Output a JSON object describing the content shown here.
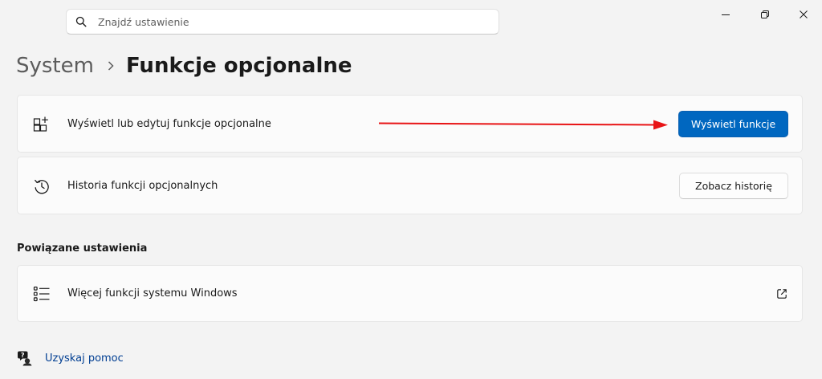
{
  "search": {
    "placeholder": "Znajdź ustawienie",
    "icon": "search-icon"
  },
  "window_controls": {
    "minimize_icon": "minimize-icon",
    "restore_icon": "restore-icon",
    "close_icon": "close-icon"
  },
  "breadcrumb": {
    "parent": "System",
    "current": "Funkcje opcjonalne"
  },
  "cards": [
    {
      "icon": "add-feature-icon",
      "label": "Wyświetl lub edytuj funkcje opcjonalne",
      "button": "Wyświetl funkcje"
    },
    {
      "icon": "history-icon",
      "label": "Historia funkcji opcjonalnych",
      "button": "Zobacz historię"
    }
  ],
  "related": {
    "title": "Powiązane ustawienia",
    "items": [
      {
        "icon": "list-icon",
        "label": "Więcej funkcji systemu Windows",
        "trailing_icon": "external-link-icon"
      }
    ]
  },
  "help": {
    "icon": "help-icon",
    "label": "Uzyskaj pomoc"
  },
  "colors": {
    "accent": "#0067c0",
    "annotation_arrow": "#e81416",
    "link": "#003e92",
    "background": "#f3f3f3",
    "card": "#fbfbfb"
  }
}
